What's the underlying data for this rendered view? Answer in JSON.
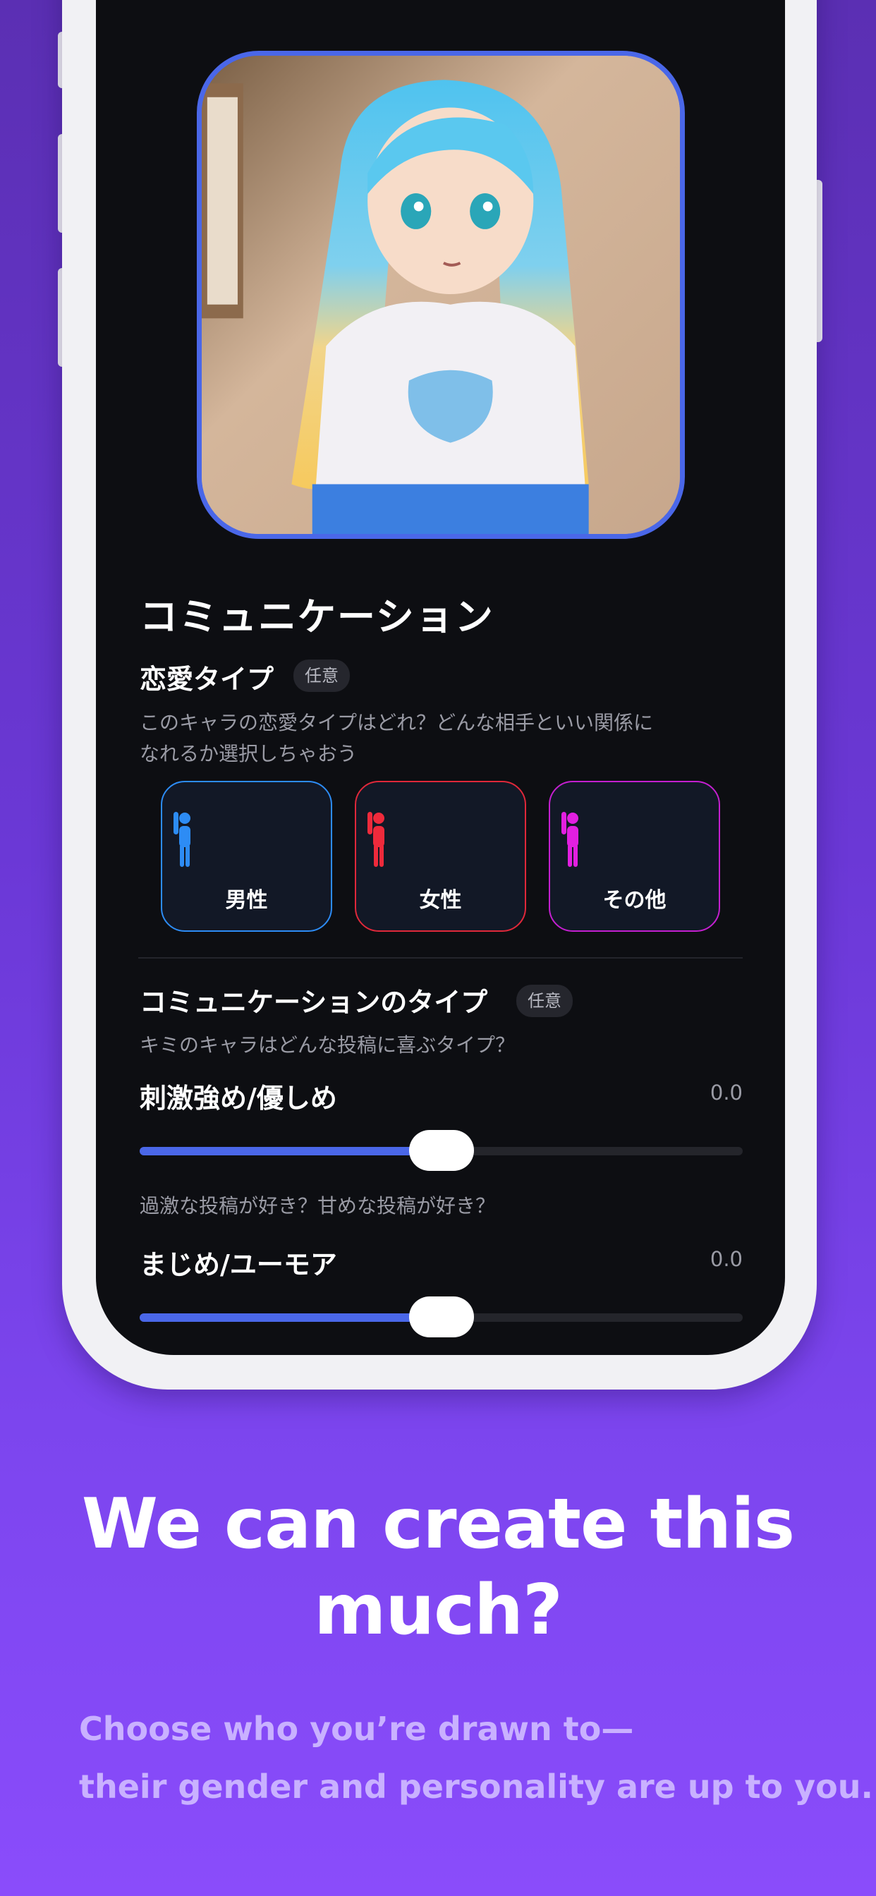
{
  "colors": {
    "accent": "#4a67e8",
    "male": "#2d8cf5",
    "female": "#ee2a3b",
    "other": "#e21fe0"
  },
  "section": {
    "title": "コミュニケーション",
    "love_type": {
      "label": "恋愛タイプ",
      "badge": "任意",
      "description_line1": "このキャラの恋愛タイプはどれ？どんな相手といい関係に",
      "description_line2": "なれるか選択しちゃおう",
      "options": [
        {
          "label": "男性",
          "icon": "person-raising-hand-icon"
        },
        {
          "label": "女性",
          "icon": "person-raising-hand-icon"
        },
        {
          "label": "その他",
          "icon": "person-raising-hand-icon"
        }
      ]
    },
    "communication_type": {
      "label": "コミュニケーションのタイプ",
      "badge": "任意",
      "description": "キミのキャラはどんな投稿に喜ぶタイプ？",
      "sliders": [
        {
          "label": "刺激強め/優しめ",
          "value_text": "0.0",
          "position": 0.5,
          "hint": "過激な投稿が好き？甘めな投稿が好き？"
        },
        {
          "label": "まじめ/ユーモア",
          "value_text": "0.0",
          "position": 0.5
        }
      ]
    }
  },
  "promo": {
    "headline_line1": "We can create this",
    "headline_line2": "much?",
    "caption_line1": "Choose who you’re drawn to—",
    "caption_line2": "their gender and personality are up to you."
  }
}
